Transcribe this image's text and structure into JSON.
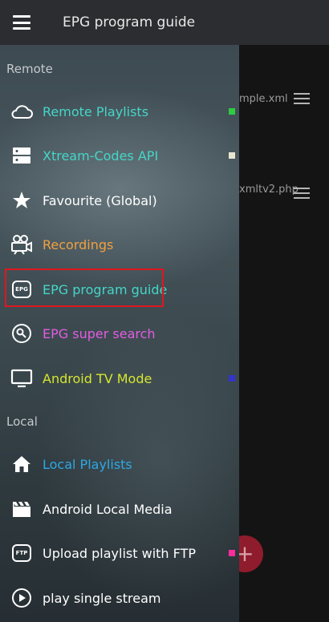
{
  "appbar": {
    "title": "EPG program guide"
  },
  "background": {
    "row1_text": "mple.xml",
    "row2_text": "xmltv2.php",
    "fab_glyph": "+"
  },
  "drawer": {
    "sections": {
      "remote": "Remote",
      "local": "Local"
    },
    "remote_items": [
      {
        "label": "Remote Playlists",
        "icon": "cloud-icon",
        "color": "#45d6c8",
        "indicator": "#2ecc40"
      },
      {
        "label": "Xtream-Codes API",
        "icon": "server-icon",
        "color": "#45d6c8",
        "indicator": "#e8e6d0"
      },
      {
        "label": "Favourite (Global)",
        "icon": "star-icon",
        "color": "#ffffff"
      },
      {
        "label": "Recordings",
        "icon": "video-camera-icon",
        "color": "#f0a040"
      },
      {
        "label": "EPG program guide",
        "icon": "epg-icon",
        "icon_text": "EPG",
        "color": "#45d6c8"
      },
      {
        "label": "EPG super search",
        "icon": "search-icon",
        "color": "#e35ce0"
      },
      {
        "label": "Android TV Mode",
        "icon": "tv-icon",
        "color": "#d6e62e",
        "indicator": "#3333cc"
      }
    ],
    "local_items": [
      {
        "label": "Local Playlists",
        "icon": "home-icon",
        "color": "#2ea8e6"
      },
      {
        "label": "Android Local Media",
        "icon": "clapperboard-icon",
        "color": "#ffffff"
      },
      {
        "label": "Upload playlist with FTP",
        "icon": "ftp-icon",
        "icon_text": "FTP",
        "color": "#ffffff",
        "indicator": "#ff2d9a"
      },
      {
        "label": "play single stream",
        "icon": "play-circle-icon",
        "color": "#ffffff"
      }
    ]
  }
}
